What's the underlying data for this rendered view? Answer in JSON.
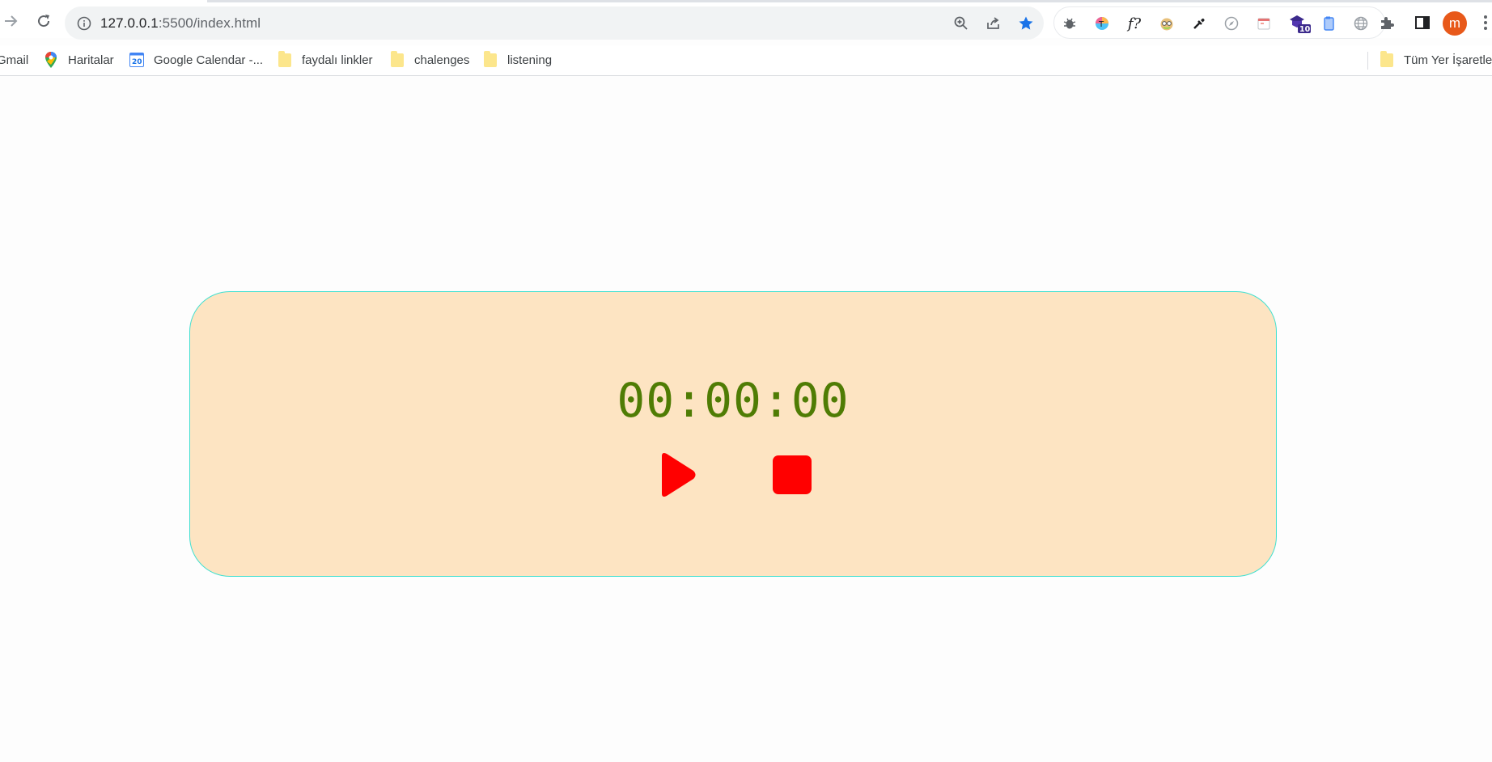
{
  "browser": {
    "url_host": "127.0.0.1",
    "url_path": ":5500/index.html",
    "profile_initial": "m",
    "extension_badge": "10",
    "icons": [
      "forward-icon",
      "reload-icon",
      "info-icon",
      "zoom-icon",
      "share-icon",
      "bookmark-star-icon",
      "puzzle-icon",
      "side-panel-icon",
      "menu-icon"
    ]
  },
  "bookmarks": {
    "items": [
      {
        "label": "Gmail"
      },
      {
        "label": "Haritalar"
      },
      {
        "label": "Google Calendar -..."
      },
      {
        "label": "faydalı linkler"
      },
      {
        "label": "chalenges"
      },
      {
        "label": "listening"
      }
    ],
    "other": "Tüm Yer İşaretleri"
  },
  "stopwatch": {
    "time": "00:00:00",
    "colors": {
      "panel": "#fde4c2",
      "border": "#40e0d0",
      "time": "#4f7c04",
      "controls": "#ff0000"
    }
  }
}
